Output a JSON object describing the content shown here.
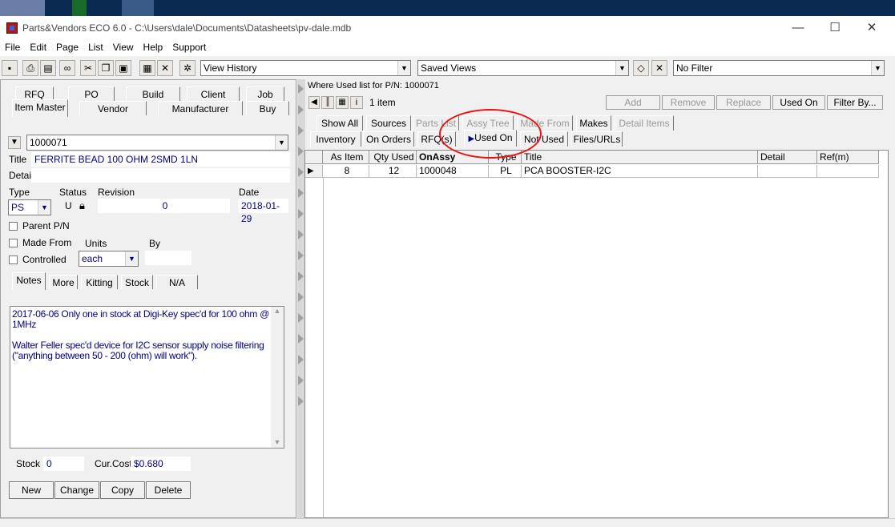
{
  "window": {
    "title": "Parts&Vendors ECO 6.0 - C:\\Users\\dale\\Documents\\Datasheets\\pv-dale.mdb",
    "minimize": "—",
    "maximize": "☐",
    "close": "✕"
  },
  "menu": [
    "File",
    "Edit",
    "Page",
    "List",
    "View",
    "Help",
    "Support"
  ],
  "toolbar": {
    "view_history": "View History",
    "saved_views": "Saved Views",
    "filter": "No Filter"
  },
  "left": {
    "tabs_top": [
      "RFQ",
      "PO",
      "Build",
      "Client",
      "Job"
    ],
    "tabs_bottom": [
      "Item Master",
      "Vendor",
      "Manufacturer",
      "Buy"
    ],
    "part_number": "1000071",
    "title_label": "Title",
    "title_value": "FERRITE BEAD 100 OHM 2SMD 1LN",
    "detail_label": "Detail",
    "type_label": "Type",
    "status_label": "Status",
    "revision_label": "Revision",
    "date_label": "Date",
    "type_value": "PS",
    "status_value": "U",
    "revision_value": "0",
    "date_value": "2018-01-29",
    "parent_pn": "Parent P/N",
    "made_from": "Made From",
    "units_label": "Units",
    "by_label": "By",
    "units_value": "each",
    "controlled": "Controlled",
    "note_tabs": [
      "Notes",
      "More",
      "Kitting",
      "Stock",
      "N/A"
    ],
    "notes_line1": "2017-06-06 Only one in stock at Digi-Key spec'd for 100 ohm @",
    "notes_line2": "1MHz",
    "notes_line3": "Walter Feller spec'd device for I2C sensor supply noise filtering",
    "notes_line4": "(\"anything between 50 - 200 (ohm) will work\").",
    "stock_label": "Stock",
    "stock_value": "0",
    "curcost_label": "Cur.Cost",
    "curcost_value": "$0.680",
    "buttons": [
      "New",
      "Change",
      "Copy",
      "Delete"
    ]
  },
  "right": {
    "where_used": "Where Used list for P/N:  1000071",
    "item_count": "1 item",
    "actions": [
      "Add",
      "Remove",
      "Replace",
      "Used On",
      "Filter By..."
    ],
    "tabs_row1": [
      "Show All",
      "Sources",
      "Parts List",
      "Assy Tree",
      "Made From",
      "Makes",
      "Detail Items"
    ],
    "tabs_row2": [
      "Inventory",
      "On Orders",
      "RFQ(s)",
      "Used On",
      "Not Used",
      "Files/URLs"
    ],
    "columns": [
      "As Item",
      "Qty Used",
      "OnAssy",
      "Type",
      "Title",
      "Detail",
      "Ref(m)"
    ],
    "rows": [
      {
        "as_item": "8",
        "qty_used": "12",
        "on_assy": "1000048",
        "type": "PL",
        "title": "PCA BOOSTER-I2C",
        "detail": "",
        "ref": ""
      }
    ]
  },
  "colors": {
    "accent_text": "#000080",
    "highlight_circle": "#ee1111"
  }
}
